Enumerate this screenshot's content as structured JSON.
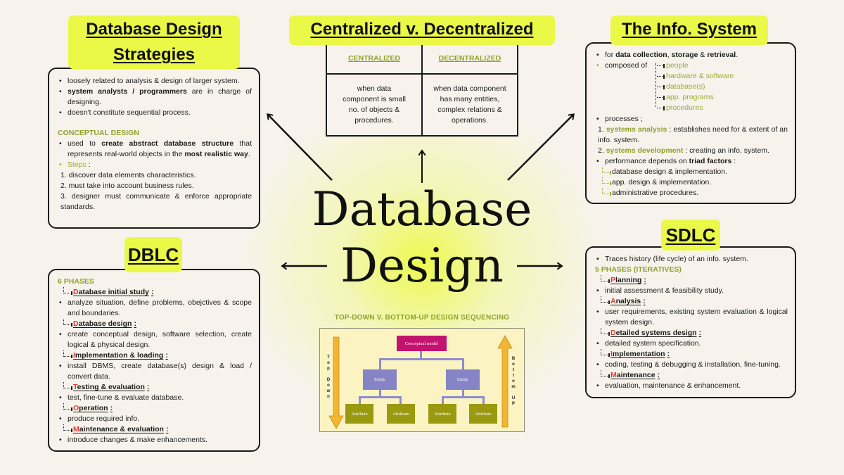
{
  "center": {
    "title_line1": "Database",
    "title_line2": "Design"
  },
  "strategies": {
    "title_line1": "Database Design",
    "title_line2": "Strategies",
    "bullets": [
      {
        "pre": "loosely related to analysis & design of larger system.",
        "bold": "",
        "post": ""
      },
      {
        "pre": "",
        "bold": "system analysts / programmers",
        "post": " are in charge of designing."
      },
      {
        "pre": "doesn't constitute sequential process.",
        "bold": "",
        "post": ""
      }
    ],
    "conceptual_heading": "CONCEPTUAL DESIGN",
    "conceptual_bullet": {
      "p1": "used to ",
      "b1": "create abstract database structure",
      "p2": " that represents real-world objects in the ",
      "b2": "most realistic way",
      "p3": "."
    },
    "steps_label": "Steps",
    "steps_colon": " :",
    "steps": [
      "1. discover data elements characteristics.",
      "2. must take into account business rules.",
      "3. designer must communicate & enforce appropriate standards."
    ]
  },
  "centralized": {
    "title": "Centralized v. Decentralized",
    "col1_header": "CENTRALIZED",
    "col2_header": "DECENTRALIZED",
    "col1_text": "when data component is small no. of objects & procedures.",
    "col2_text": "when data component has many entities, complex relations & operations."
  },
  "info_system": {
    "title": "The Info. System",
    "line1": {
      "p1": "for ",
      "b1": "data collection",
      "p2": ", ",
      "b2": "storage",
      "p3": " & ",
      "b3": "retrieval",
      "p4": "."
    },
    "composed_label": "composed of",
    "components": [
      "people",
      "hardware & software",
      "database(s)",
      "app. programs",
      "procedures"
    ],
    "processes_label": "processes ;",
    "processes": [
      {
        "num": "1. ",
        "name": "systems analysis",
        "desc": " : establishes need for & extent of an info. system."
      },
      {
        "num": "2. ",
        "name": "systems development",
        "desc": " : creating an info. system."
      }
    ],
    "performance": {
      "pre": "performance depends on ",
      "bold": "triad factors",
      "post": " :"
    },
    "triad": [
      "database design & implementation.",
      "app. design & implementation.",
      "administrative procedures."
    ]
  },
  "dblc": {
    "title": "DBLC",
    "heading": "6 PHASES",
    "phases": [
      {
        "initial": "D",
        "rest": "atabase initial study",
        "desc": "analyze situation, define problems, obejctives & scope and boundaries."
      },
      {
        "initial": "D",
        "rest": "atabase design",
        "desc": "create conceptual design, software selection, create logical & physical design."
      },
      {
        "initial": "I",
        "rest": "mplementation & loading",
        "desc": "install DBMS, create database(s) design & load / convert data."
      },
      {
        "initial": "T",
        "rest": "esting & evaluation",
        "desc": "test, fine-tune & evaluate database."
      },
      {
        "initial": "O",
        "rest": "peration",
        "desc": "produce required info."
      },
      {
        "initial": "M",
        "rest": "aintenance & evaluation",
        "desc": "introduce changes & make enhancements."
      }
    ]
  },
  "sdlc": {
    "title": "SDLC",
    "intro": "Traces history (life cycle) of an info. system.",
    "heading": "5 PHASES (ITERATIVES)",
    "phases": [
      {
        "initial": "P",
        "rest": "lanning",
        "desc": "initial assessment & feasibility study."
      },
      {
        "initial": "A",
        "rest": "nalysis",
        "desc": "user requirements, existing system evaluation & logical system design."
      },
      {
        "initial": "D",
        "rest": "etailed systems design",
        "desc": "detailed system specification."
      },
      {
        "initial": "I",
        "rest": "mplementation",
        "desc": "coding, testing & debugging & installation, fine-tuning."
      },
      {
        "initial": "M",
        "rest": "aintenance",
        "desc": "evaluation, maintenance & enhancement."
      }
    ]
  },
  "sequencing": {
    "title": "TOP-DOWN V. BOTTOM-UP DESIGN SEQUENCING",
    "top_node": "Conceptual model",
    "entity_label": "Entity",
    "attribute_label": "Attribute",
    "left_label": [
      "T",
      "o",
      "p",
      "",
      "D",
      "o",
      "w",
      "n"
    ],
    "right_label": [
      "B",
      "o",
      "t",
      "t",
      "o",
      "m",
      "",
      "U",
      "P"
    ]
  },
  "colors": {
    "background": "#f7f3ec",
    "highlight": "#eaf848",
    "olive": "#8fa127",
    "initial_red": "#e8382f",
    "concept_node": "#c2136f",
    "entity_node": "#8484c6",
    "attribute_node": "#9a9a10",
    "arrow_gold": "#f2b632"
  }
}
